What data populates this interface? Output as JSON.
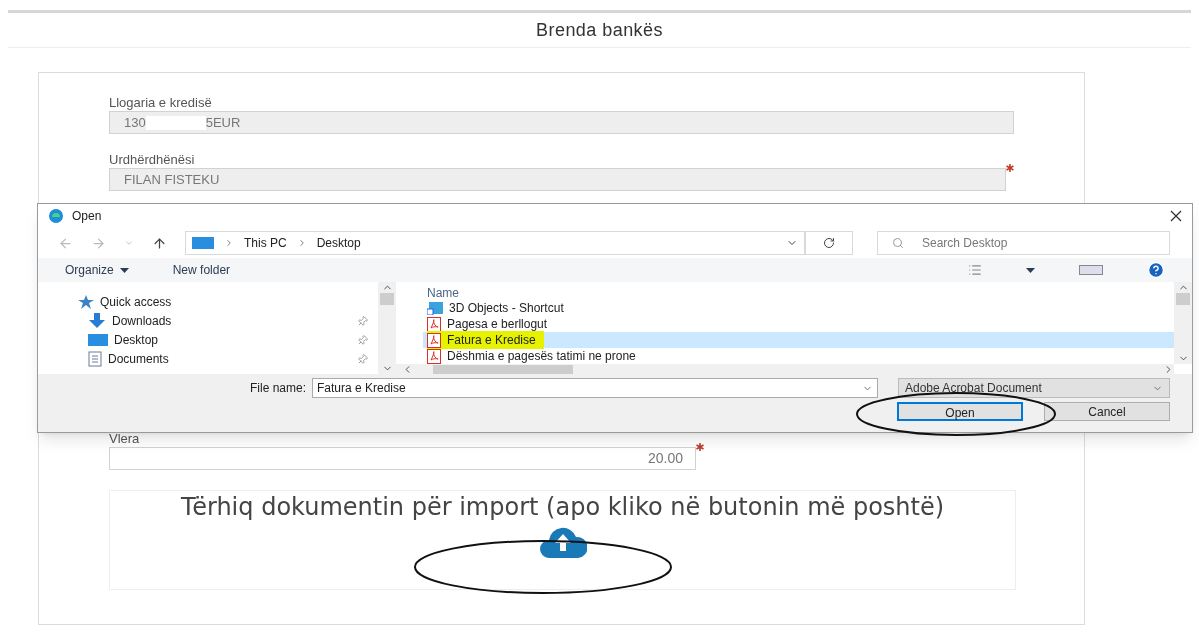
{
  "page": {
    "title": "Brenda bankës"
  },
  "form": {
    "fields": [
      {
        "label": "Llogaria e kredisë",
        "value_parts": [
          "130",
          "5EUR"
        ],
        "required": false
      },
      {
        "label": "Urdhërdhënësi",
        "value_parts": [
          "FILAN FISTEKU"
        ],
        "required": true
      }
    ],
    "amount": {
      "label": "Vlera",
      "value": "20.00",
      "required": true
    },
    "dropzone": {
      "text": "Tërhiq dokumentin për import (apo kliko në butonin më poshtë)"
    }
  },
  "dialog": {
    "title": "Open",
    "breadcrumb": [
      "This PC",
      "Desktop"
    ],
    "search": {
      "placeholder": "Search Desktop"
    },
    "toolbar": [
      "Organize",
      "New folder"
    ],
    "nav_items": [
      {
        "label": "Quick access",
        "kind": "star",
        "pinned": false
      },
      {
        "label": "Downloads",
        "kind": "download",
        "pinned": true
      },
      {
        "label": "Desktop",
        "kind": "desktop",
        "pinned": true
      },
      {
        "label": "Documents",
        "kind": "document",
        "pinned": true
      }
    ],
    "list_header": "Name",
    "files": [
      {
        "name": "3D Objects - Shortcut",
        "kind": "shortcut",
        "selected": false,
        "highlighted": false
      },
      {
        "name": "Pagesa e berllogut",
        "kind": "pdf",
        "selected": false,
        "highlighted": false
      },
      {
        "name": "Fatura e Kredise",
        "kind": "pdf",
        "selected": true,
        "highlighted": true
      },
      {
        "name": "Dëshmia e pagesës tatimi ne prone",
        "kind": "pdf",
        "selected": false,
        "highlighted": false
      }
    ],
    "file_name": {
      "label": "File name:",
      "value": "Fatura e Kredise"
    },
    "file_type": "Adobe Acrobat Document",
    "buttons": [
      {
        "label": "Open",
        "default": true
      },
      {
        "label": "Cancel",
        "default": false
      }
    ]
  }
}
